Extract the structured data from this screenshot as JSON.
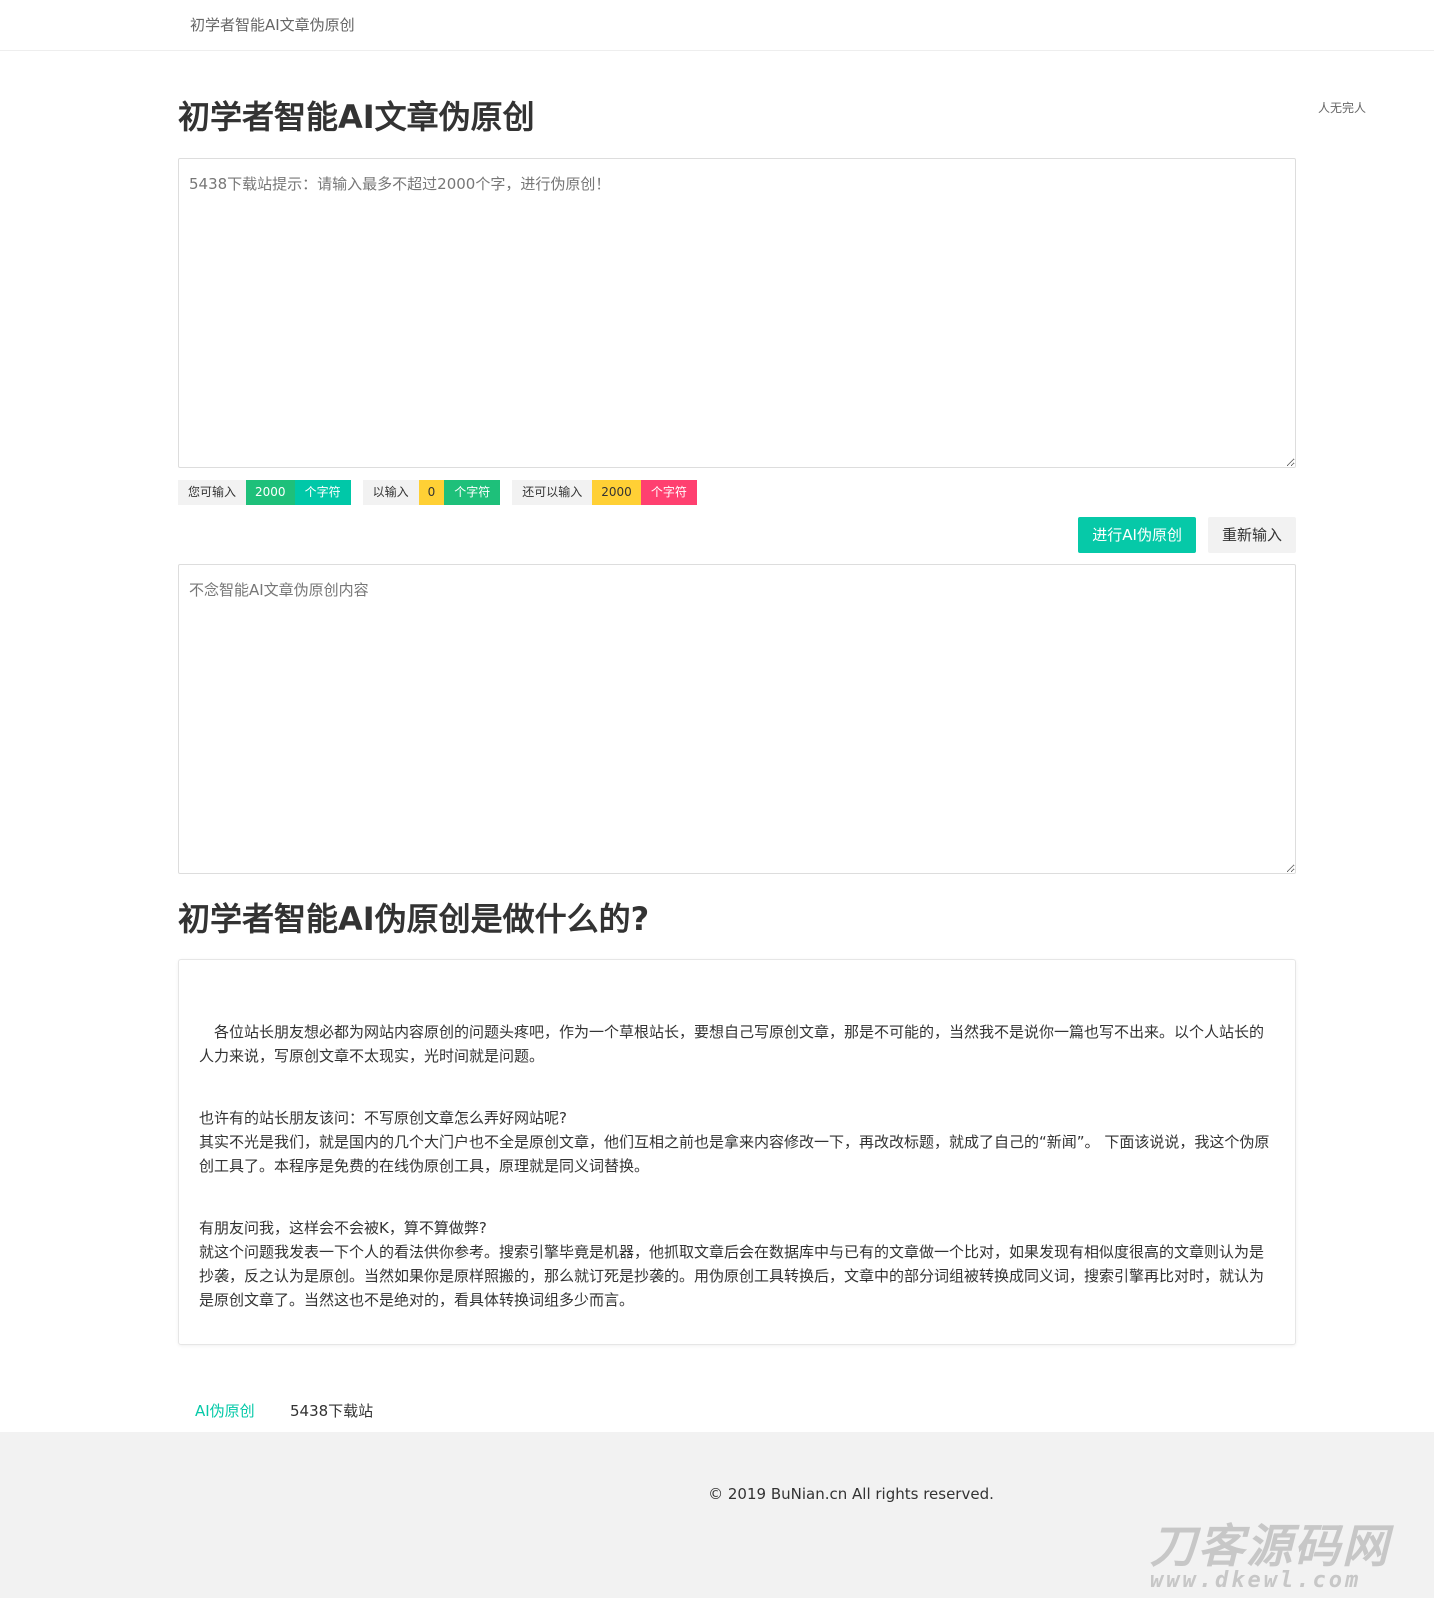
{
  "topbar": {
    "brand": "初学者智能AI文章伪原创"
  },
  "side_note": "人无完人",
  "page": {
    "title": "初学者智能AI文章伪原创"
  },
  "input": {
    "placeholder": "5438下载站提示：请输入最多不超过2000个字，进行伪原创！",
    "value": ""
  },
  "counters": [
    {
      "label": "您可输入",
      "value": "2000",
      "unit": "个字符",
      "value_color": "#1ec07a",
      "unit_color": "#00c8a8"
    },
    {
      "label": "以输入",
      "value": "0",
      "unit": "个字符",
      "value_color": "#ffd035",
      "unit_color": "#1ec07a"
    },
    {
      "label": "还可以输入",
      "value": "2000",
      "unit": "个字符",
      "value_color": "#ffd035",
      "unit_color": "#ff4070"
    }
  ],
  "actions": {
    "submit": "进行AI伪原创",
    "reset": "重新输入"
  },
  "output": {
    "placeholder": "不念智能AI文章伪原创内容",
    "value": ""
  },
  "about": {
    "title": "初学者智能AI伪原创是做什么的?",
    "paragraphs": [
      "各位站长朋友想必都为网站内容原创的问题头疼吧，作为一个草根站长，要想自己写原创文章，那是不可能的，当然我不是说你一篇也写不出来。以个人站长的人力来说，写原创文章不太现实，光时间就是问题。",
      "也许有的站长朋友该问：不写原创文章怎么弄好网站呢?\n其实不光是我们，就是国内的几个大门户也不全是原创文章，他们互相之前也是拿来内容修改一下，再改改标题，就成了自己的“新闻”。 下面该说说，我这个伪原创工具了。本程序是免费的在线伪原创工具，原理就是同义词替换。",
      "有朋友问我，这样会不会被K，算不算做弊?\n就这个问题我发表一下个人的看法供你参考。搜索引擎毕竟是机器，他抓取文章后会在数据库中与已有的文章做一个比对，如果发现有相似度很高的文章则认为是抄袭，反之认为是原创。当然如果你是原样照搬的，那么就订死是抄袭的。用伪原创工具转换后，文章中的部分词组被转换成同义词，搜索引擎再比对时，就认为是原创文章了。当然这也不是绝对的，看具体转换词组多少而言。"
    ]
  },
  "footer_links": {
    "active": "AI伪原创",
    "other": "5438下载站"
  },
  "footer": {
    "copyright": "© 2019 BuNian.cn All rights reserved."
  },
  "watermark": {
    "main": "刀客源码网",
    "sub": "www.dkewl.com"
  },
  "colors": {
    "accent": "#06c9a8",
    "border": "#dddddd",
    "footer_bg": "#f2f2f2"
  }
}
